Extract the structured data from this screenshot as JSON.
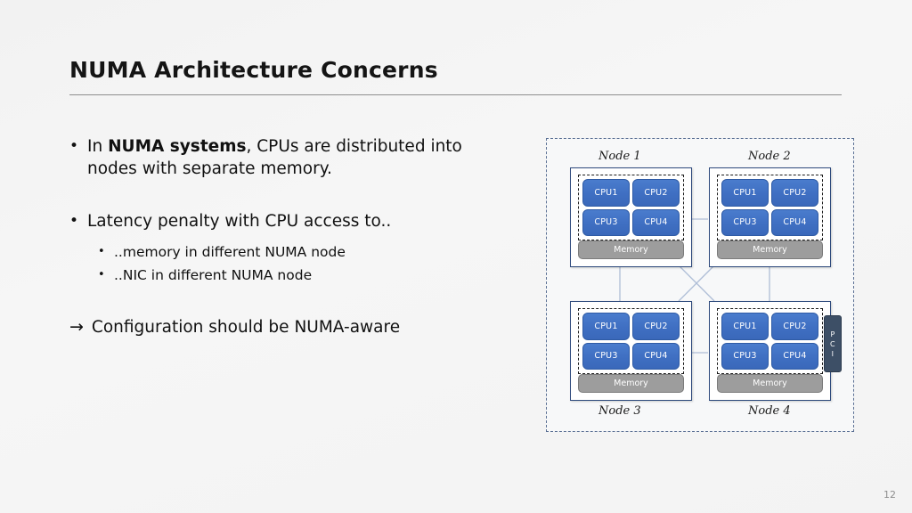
{
  "slide": {
    "title": "NUMA Architecture Concerns",
    "page_number": "12",
    "background_color": "#f4f4f4",
    "rule_color": "#8e8e8e"
  },
  "content": {
    "bullet1": {
      "marker": "•",
      "text_before_bold": "In ",
      "bold_text": "NUMA systems",
      "text_after_bold": ", CPUs are distributed into nodes with separate memory."
    },
    "bullet2": {
      "marker": "•",
      "text": "Latency penalty with CPU access to..",
      "sub_bullets": [
        {
          "marker": "•",
          "text": "..memory in different NUMA node"
        },
        {
          "marker": "•",
          "text": "..NIC in different NUMA node"
        }
      ]
    },
    "conclusion": {
      "arrow": "→",
      "text": "Configuration should be NUMA-aware"
    }
  },
  "diagram": {
    "colors": {
      "cpu_fill": "#3f6fc2",
      "memory_fill": "#9d9d9d",
      "node_border": "#2e4a7d",
      "outer_border": "#5a6f93",
      "pci_fill": "#3d4f66",
      "link_line": "#aebdd6"
    },
    "memory_label": "Memory",
    "pci_label": "PCI",
    "pci_letters": [
      "P",
      "C",
      "I"
    ],
    "nodes": [
      {
        "label": "Node 1",
        "label_position": "above",
        "cpus": [
          "CPU1",
          "CPU2",
          "CPU3",
          "CPU4"
        ],
        "memory": "Memory"
      },
      {
        "label": "Node 2",
        "label_position": "above",
        "cpus": [
          "CPU1",
          "CPU2",
          "CPU3",
          "CPU4"
        ],
        "memory": "Memory"
      },
      {
        "label": "Node 3",
        "label_position": "below",
        "cpus": [
          "CPU1",
          "CPU2",
          "CPU3",
          "CPU4"
        ],
        "memory": "Memory"
      },
      {
        "label": "Node 4",
        "label_position": "below",
        "cpus": [
          "CPU1",
          "CPU2",
          "CPU3",
          "CPU4"
        ],
        "memory": "Memory"
      }
    ]
  }
}
